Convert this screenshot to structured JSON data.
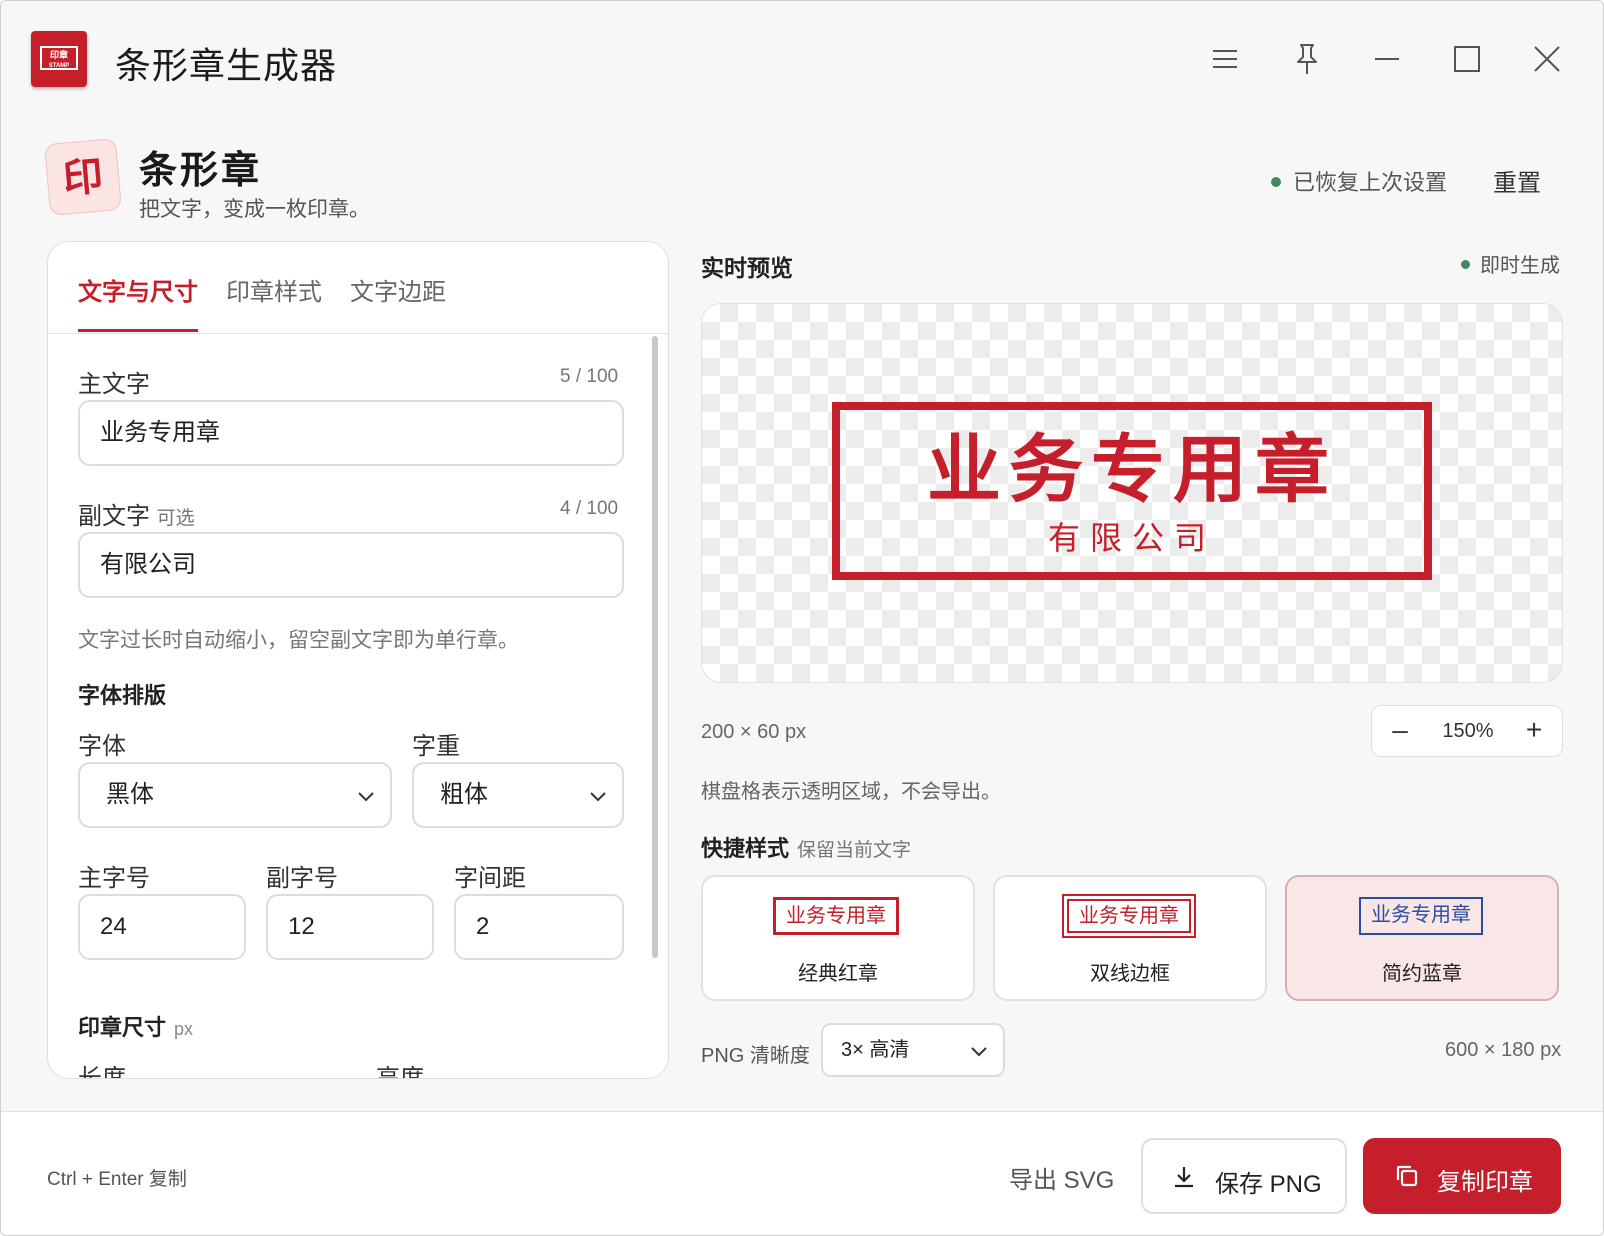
{
  "window": {
    "title": "条形章生成器",
    "icon_label": "印章\nSTAMP",
    "controls": [
      "menu-icon",
      "pin-icon",
      "minimize-icon",
      "maximize-icon",
      "close-icon"
    ]
  },
  "header": {
    "brand_glyph": "印",
    "title": "条形章",
    "subtitle": "把文字，变成一枚印章。",
    "restore_status": "已恢复上次设置",
    "reset_label": "重置"
  },
  "tabs": [
    {
      "label": "文字与尺寸",
      "active": true
    },
    {
      "label": "印章样式",
      "active": false
    },
    {
      "label": "文字边距",
      "active": false
    }
  ],
  "form": {
    "main_text": {
      "label": "主文字",
      "counter": "5 / 100",
      "value": "业务专用章"
    },
    "sub_text": {
      "label": "副文字",
      "optional": "可选",
      "counter": "4 / 100",
      "value": "有限公司"
    },
    "hint": "文字过长时自动缩小，留空副文字即为单行章。",
    "typography_section": "字体排版",
    "font": {
      "label": "字体",
      "value": "黑体"
    },
    "weight": {
      "label": "字重",
      "value": "粗体"
    },
    "main_size": {
      "label": "主字号",
      "value": "24"
    },
    "sub_size": {
      "label": "副字号",
      "value": "12"
    },
    "spacing": {
      "label": "字间距",
      "value": "2"
    },
    "size_section": "印章尺寸",
    "size_unit": "px",
    "length_label": "长度",
    "height_label": "高度"
  },
  "preview": {
    "title": "实时预览",
    "instant": "即时生成",
    "stamp_main": "业务专用章",
    "stamp_sub": "有限公司",
    "dimensions": "200 × 60 px",
    "zoom_minus": "–",
    "zoom": "150%",
    "zoom_plus": "+",
    "checker_note": "棋盘格表示透明区域，不会导出。"
  },
  "quick_styles": {
    "title": "快捷样式",
    "note": "保留当前文字",
    "items": [
      {
        "preview": "业务专用章",
        "label": "经典红章",
        "color": "#c41f2b",
        "selected": false
      },
      {
        "preview": "业务专用章",
        "label": "双线边框",
        "color": "#c41f2b",
        "selected": false
      },
      {
        "preview": "业务专用章",
        "label": "简约蓝章",
        "color": "#2b4ea0",
        "selected": true
      }
    ]
  },
  "export": {
    "png_label": "PNG 清晰度",
    "png_value": "3× 高清",
    "png_dimensions": "600 × 180 px"
  },
  "footer": {
    "shortcut": "Ctrl + Enter 复制",
    "export_svg": "导出 SVG",
    "save_png": "保存 PNG",
    "copy": "复制印章"
  },
  "colors": {
    "accent": "#c41f2b",
    "blue": "#2b4ea0",
    "status_green": "#3f8a5c"
  }
}
